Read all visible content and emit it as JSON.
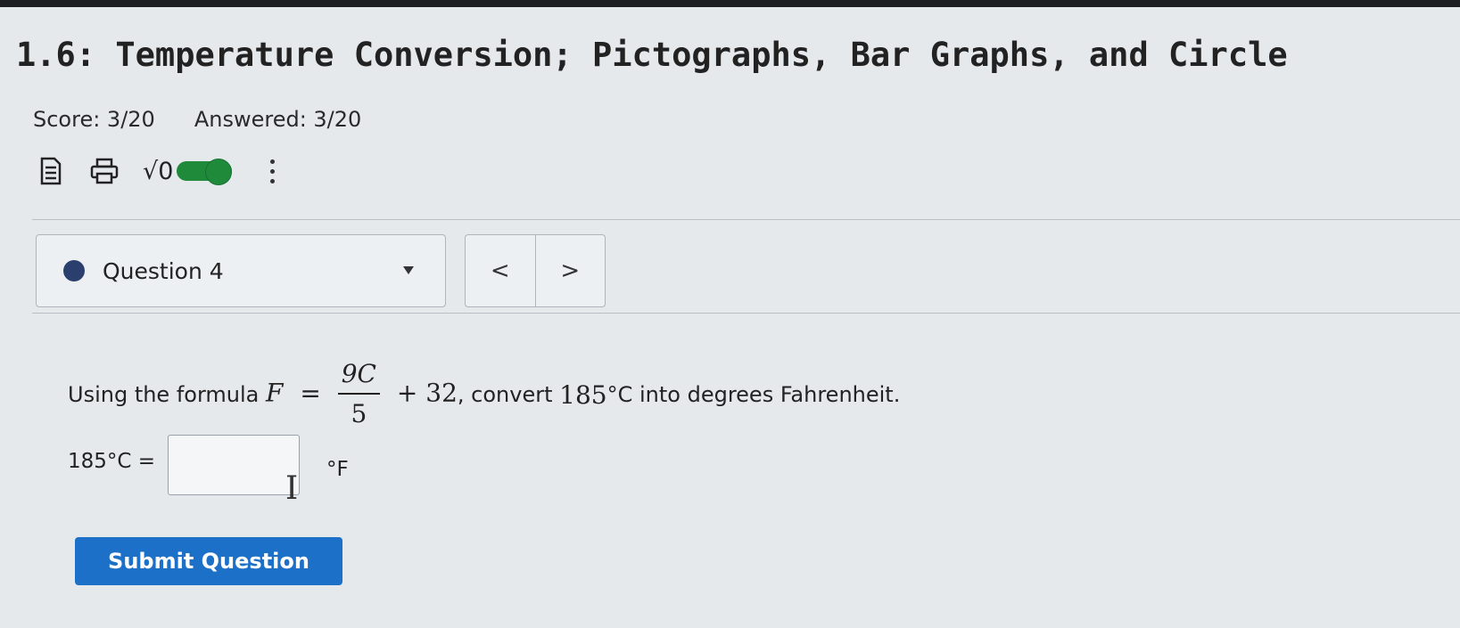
{
  "assignment": {
    "title": "1.6: Temperature Conversion; Pictographs, Bar Graphs, and Circle",
    "score": "Score: 3/20",
    "answered": "Answered: 3/20"
  },
  "toolbar": {
    "icons": [
      "document-icon",
      "print-icon",
      "math-input-toggle",
      "more-options-icon"
    ],
    "sqrt_label": "√0"
  },
  "question_nav": {
    "label": "Question 4",
    "prev": "<",
    "next": ">"
  },
  "question": {
    "intro": "Using the formula",
    "formula_lhs": "F",
    "equals": "=",
    "numerator": "9C",
    "denominator": "5",
    "plus_const": "+ 32",
    "mid_text": ", convert",
    "value": "185",
    "deg_unit": "°C",
    "tail_text": "into degrees Fahrenheit."
  },
  "answer": {
    "prefix": "185°C =",
    "value": "",
    "unit": "°F"
  },
  "submit_label": "Submit Question",
  "colors": {
    "accent": "#1c70c8",
    "toggle": "#1f8a3a",
    "status_dot": "#2a3f6e"
  }
}
